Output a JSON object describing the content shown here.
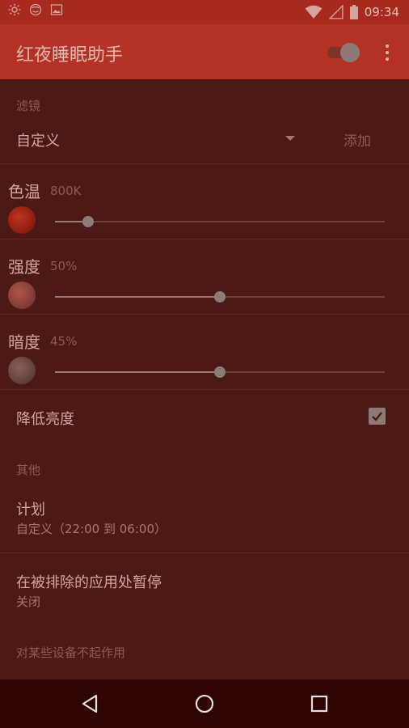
{
  "status_bar": {
    "time": "09:34",
    "left_icons": [
      "brightness-icon",
      "face-icon",
      "image-icon"
    ],
    "right_icons": [
      "wifi-icon",
      "signal-icon",
      "battery-icon"
    ]
  },
  "app_bar": {
    "title": "红夜睡眠助手",
    "master_toggle_on": true
  },
  "filter": {
    "section_label": "滤镜",
    "selected": "自定义",
    "add_label": "添加"
  },
  "sliders": [
    {
      "title": "色温",
      "value_text": "800K",
      "level": 0.1
    },
    {
      "title": "强度",
      "value_text": "50%",
      "level": 0.5
    },
    {
      "title": "暗度",
      "value_text": "45%",
      "level": 0.5
    }
  ],
  "dim_brightness": {
    "label": "降低亮度",
    "checked": true
  },
  "other": {
    "section_label": "其他",
    "schedule_title": "计划",
    "schedule_value": "自定义（22:00 到 06:00）",
    "pause_title": "在被排除的应用处暂停",
    "pause_value": "关闭",
    "note": "对某些设备不起作用"
  },
  "colors": {
    "app_bar": "#b23326",
    "background": "#4b1a15",
    "nav_bar": "#2e0503"
  }
}
